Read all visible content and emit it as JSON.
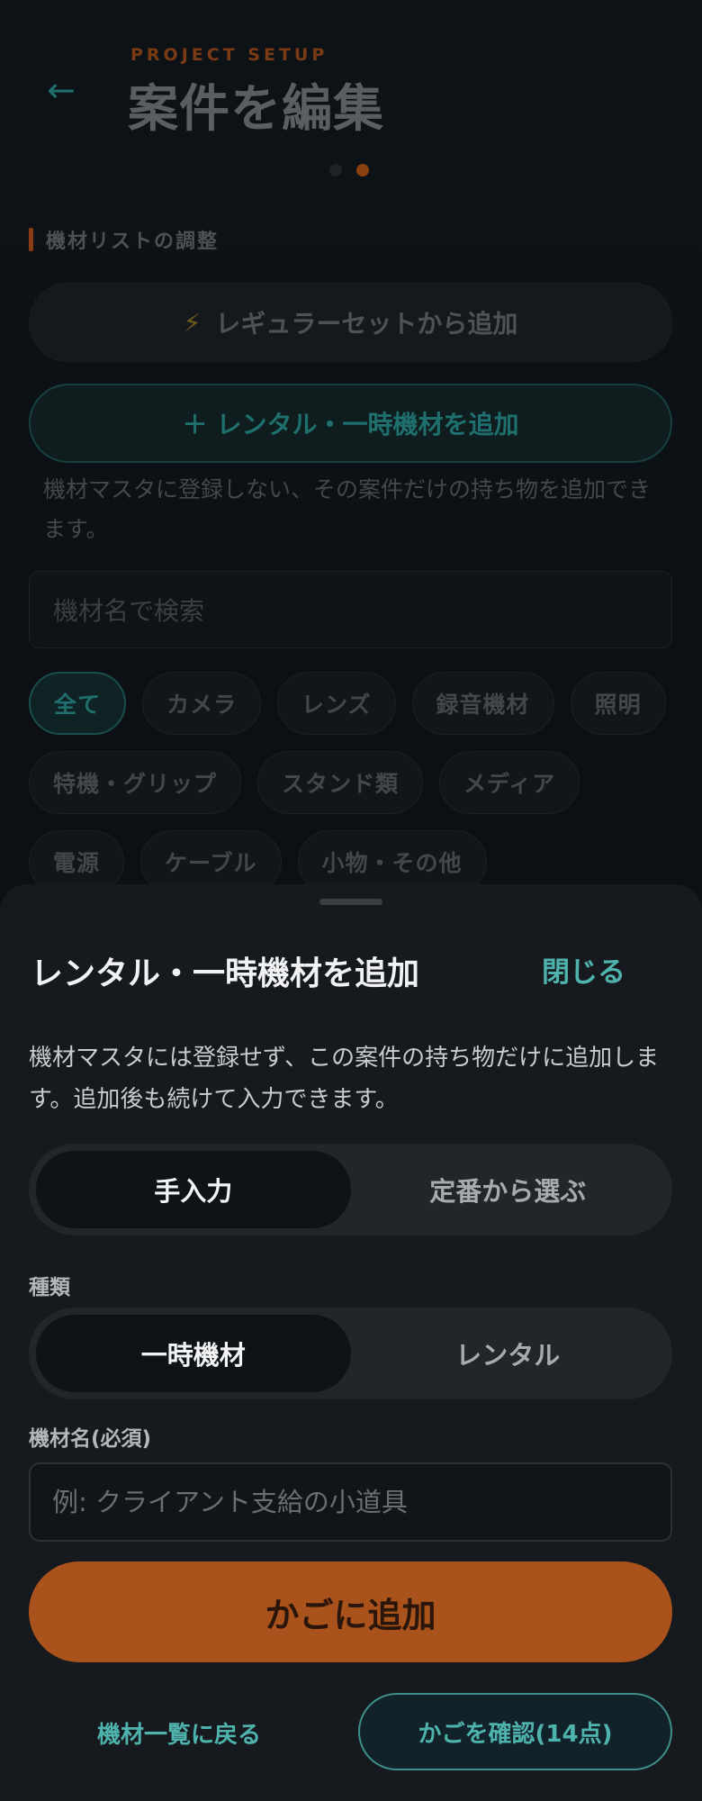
{
  "header": {
    "back_icon": "arrow-left-icon",
    "eyebrow": "PROJECT SETUP",
    "title": "案件を編集"
  },
  "pager": {
    "current": 2,
    "total": 2
  },
  "section": {
    "label": "機材リストの調整"
  },
  "actions": {
    "regular_set_label": "レギュラーセットから追加",
    "regular_set_icon": "lightning-icon",
    "rental_label": "レンタル・一時機材を追加",
    "rental_icon": "plus-icon",
    "rental_note": "機材マスタに登録しない、その案件だけの持ち物を追加できます。"
  },
  "search": {
    "placeholder": "機材名で検索"
  },
  "categories": {
    "row1": [
      "全て",
      "カメラ",
      "レンズ",
      "録音機材",
      "照明"
    ],
    "row2": [
      "特機・グリップ",
      "スタンド類",
      "メディア"
    ],
    "row3": [
      "電源",
      "ケーブル",
      "小物・その他"
    ],
    "selected": "全て"
  },
  "sheet": {
    "title": "レンタル・一時機材を追加",
    "close_label": "閉じる",
    "description": "機材マスタには登録せず、この案件の持ち物だけに追加します。追加後も続けて入力できます。",
    "mode_tabs": [
      "手入力",
      "定番から選ぶ"
    ],
    "mode_selected": "手入力",
    "kind_label": "種類",
    "kind_tabs": [
      "一時機材",
      "レンタル"
    ],
    "kind_selected": "一時機材",
    "name_label": "機材名(必須)",
    "name_placeholder": "例: クライアント支給の小道具",
    "name_value": "",
    "add_button": "かごに追加",
    "back_link": "機材一覧に戻る",
    "cart_button": "かごを確認(14点)"
  },
  "colors": {
    "accent_orange": "#a9521b",
    "accent_teal": "#4fb3ad",
    "sheet_bg": "#16191d"
  }
}
